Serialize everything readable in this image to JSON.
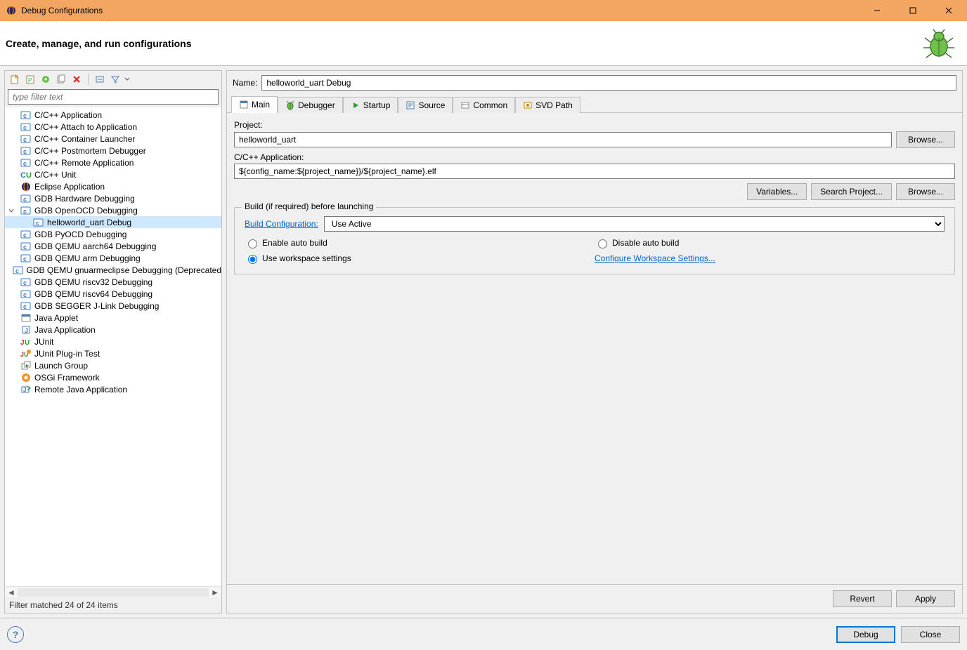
{
  "window": {
    "title": "Debug Configurations"
  },
  "banner": {
    "heading": "Create, manage, and run configurations"
  },
  "filter": {
    "placeholder": "type filter text"
  },
  "tree": [
    {
      "label": "C/C++ Application",
      "icon": "c",
      "depth": 1
    },
    {
      "label": "C/C++ Attach to Application",
      "icon": "c",
      "depth": 1
    },
    {
      "label": "C/C++ Container Launcher",
      "icon": "c",
      "depth": 1
    },
    {
      "label": "C/C++ Postmortem Debugger",
      "icon": "c",
      "depth": 1
    },
    {
      "label": "C/C++ Remote Application",
      "icon": "c",
      "depth": 1
    },
    {
      "label": "C/C++ Unit",
      "icon": "cu",
      "depth": 1
    },
    {
      "label": "Eclipse Application",
      "icon": "eclipse",
      "depth": 1
    },
    {
      "label": "GDB Hardware Debugging",
      "icon": "c",
      "depth": 1
    },
    {
      "label": "GDB OpenOCD Debugging",
      "icon": "c",
      "depth": 1,
      "expanded": true
    },
    {
      "label": "helloworld_uart Debug",
      "icon": "c",
      "depth": 2,
      "selected": true
    },
    {
      "label": "GDB PyOCD Debugging",
      "icon": "c",
      "depth": 1
    },
    {
      "label": "GDB QEMU aarch64 Debugging",
      "icon": "c",
      "depth": 1
    },
    {
      "label": "GDB QEMU arm Debugging",
      "icon": "c",
      "depth": 1
    },
    {
      "label": "GDB QEMU gnuarmeclipse Debugging (Deprecated",
      "icon": "c",
      "depth": 1
    },
    {
      "label": "GDB QEMU riscv32 Debugging",
      "icon": "c",
      "depth": 1
    },
    {
      "label": "GDB QEMU riscv64 Debugging",
      "icon": "c",
      "depth": 1
    },
    {
      "label": "GDB SEGGER J-Link Debugging",
      "icon": "c",
      "depth": 1
    },
    {
      "label": "Java Applet",
      "icon": "applet",
      "depth": 1
    },
    {
      "label": "Java Application",
      "icon": "java-app",
      "depth": 1
    },
    {
      "label": "JUnit",
      "icon": "junit",
      "depth": 1
    },
    {
      "label": "JUnit Plug-in Test",
      "icon": "junit-plugin",
      "depth": 1
    },
    {
      "label": "Launch Group",
      "icon": "launch-group",
      "depth": 1
    },
    {
      "label": "OSGi Framework",
      "icon": "osgi",
      "depth": 1
    },
    {
      "label": "Remote Java Application",
      "icon": "remote-java",
      "depth": 1
    }
  ],
  "status": "Filter matched 24 of 24 items",
  "form": {
    "name_label": "Name:",
    "name_value": "helloworld_uart Debug",
    "tabs": [
      "Main",
      "Debugger",
      "Startup",
      "Source",
      "Common",
      "SVD Path"
    ],
    "project_label": "Project:",
    "project_value": "helloworld_uart",
    "browse_label": "Browse...",
    "app_label": "C/C++ Application:",
    "app_value": "${config_name:${project_name}}/${project_name}.elf",
    "variables_label": "Variables...",
    "search_project_label": "Search Project...",
    "group_legend": "Build (if required) before launching",
    "build_config_label": "Build Configuration:",
    "build_config_value": "Use Active",
    "radio_enable": "Enable auto build",
    "radio_disable": "Disable auto build",
    "radio_workspace": "Use workspace settings",
    "configure_link": "Configure Workspace Settings...",
    "revert_label": "Revert",
    "apply_label": "Apply"
  },
  "footer": {
    "debug_label": "Debug",
    "close_label": "Close"
  }
}
